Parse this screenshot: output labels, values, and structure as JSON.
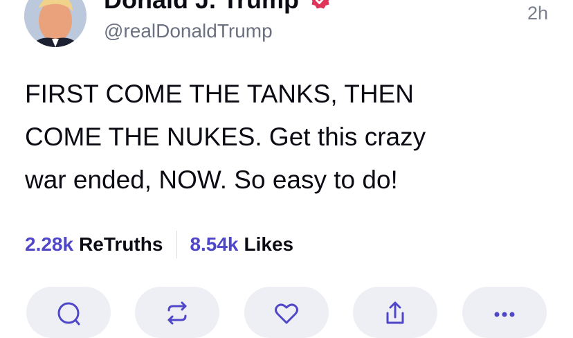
{
  "post": {
    "author": {
      "display_name": "Donald J. Trump",
      "handle": "@realDonaldTrump",
      "verified": true
    },
    "time_ago": "2h",
    "text": "FIRST COME THE TANKS, THEN\nCOME THE NUKES. Get this crazy\nwar ended, NOW. So easy to do!",
    "stats": {
      "retruths_count": "2.28k",
      "retruths_label": "ReTruths",
      "likes_count": "8.54k",
      "likes_label": "Likes"
    },
    "actions": [
      {
        "name": "reply",
        "icon": "comment-icon"
      },
      {
        "name": "retruth",
        "icon": "repost-icon"
      },
      {
        "name": "like",
        "icon": "heart-icon"
      },
      {
        "name": "share",
        "icon": "share-icon"
      },
      {
        "name": "more",
        "icon": "more-icon"
      }
    ]
  },
  "colors": {
    "accent": "#4f46c8",
    "verified_badge": "#e0335a",
    "muted_text": "#6b7180",
    "action_pill_bg": "#eeeff5"
  }
}
